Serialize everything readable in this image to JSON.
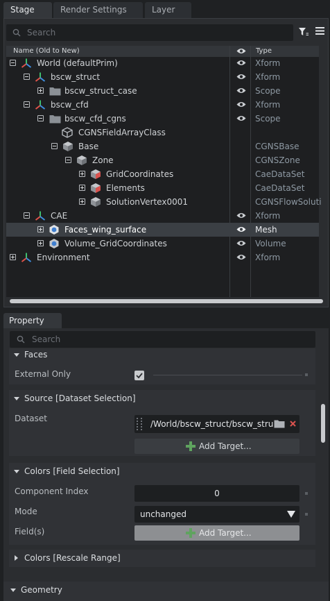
{
  "tabs": [
    {
      "label": "Stage"
    },
    {
      "label": "Render Settings"
    },
    {
      "label": "Layer"
    }
  ],
  "stage": {
    "search_placeholder": "Search",
    "col_name": "Name (Old to New)",
    "col_type": "Type",
    "rows": [
      {
        "label": "World (defaultPrim)",
        "type": "Xform"
      },
      {
        "label": "bscw_struct",
        "type": "Xform"
      },
      {
        "label": "bscw_struct_case",
        "type": "Scope"
      },
      {
        "label": "bscw_cfd",
        "type": "Xform"
      },
      {
        "label": "bscw_cfd_cgns",
        "type": "Scope"
      },
      {
        "label": "CGNSFieldArrayClass",
        "type": ""
      },
      {
        "label": "Base",
        "type": "CGNSBase"
      },
      {
        "label": "Zone",
        "type": "CGNSZone"
      },
      {
        "label": "GridCoordinates",
        "type": "CaeDataSet"
      },
      {
        "label": "Elements",
        "type": "CaeDataSet"
      },
      {
        "label": "SolutionVertex0001",
        "type": "CGNSFlowSoluti"
      },
      {
        "label": "CAE",
        "type": "Xform"
      },
      {
        "label": "Faces_wing_surface",
        "type": "Mesh"
      },
      {
        "label": "Volume_GridCoordinates",
        "type": "Volume"
      },
      {
        "label": "Environment",
        "type": "Xform"
      }
    ]
  },
  "property": {
    "tab_label": "Property",
    "search_placeholder": "Search",
    "faces": {
      "title": "Faces",
      "external_only_label": "External Only",
      "external_only_checked": true
    },
    "source": {
      "title": "Source [Dataset Selection]",
      "dataset_label": "Dataset",
      "dataset_value": "/World/bscw_struct/bscw_stru",
      "add_target": "Add Target..."
    },
    "colors": {
      "title": "Colors [Field Selection]",
      "component_index_label": "Component Index",
      "component_index_value": "0",
      "mode_label": "Mode",
      "mode_value": "unchanged",
      "fields_label": "Field(s)",
      "add_target": "Add Target..."
    },
    "rescale": {
      "title": "Colors [Rescale Range]"
    },
    "geometry": {
      "title": "Geometry"
    }
  },
  "colors": {
    "accent_green": "#5fa35f",
    "delete_red": "#d9534f",
    "xform_red": "#e0534a",
    "xform_green": "#3fbf6f",
    "xform_blue": "#3f8fe0"
  }
}
